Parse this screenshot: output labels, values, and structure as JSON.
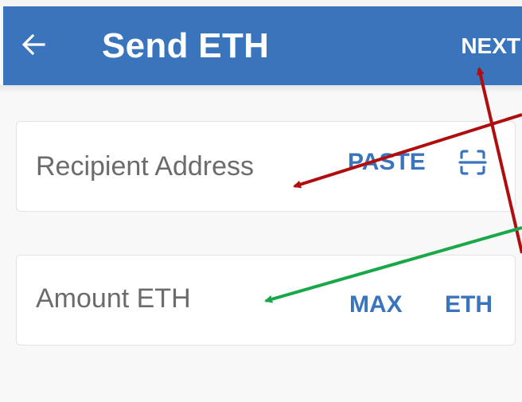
{
  "header": {
    "title": "Send ETH",
    "next_label": "NEXT",
    "back_icon": "arrow-left-icon",
    "color": "#3a74bd"
  },
  "form": {
    "recipient": {
      "placeholder": "Recipient Address",
      "paste_label": "PASTE",
      "scan_icon": "scan-qr-icon"
    },
    "amount": {
      "placeholder": "Amount ETH",
      "max_label": "MAX",
      "unit_label": "ETH"
    }
  },
  "annotations": {
    "arrow_colors": [
      "#b00e0e",
      "#18a848"
    ]
  }
}
